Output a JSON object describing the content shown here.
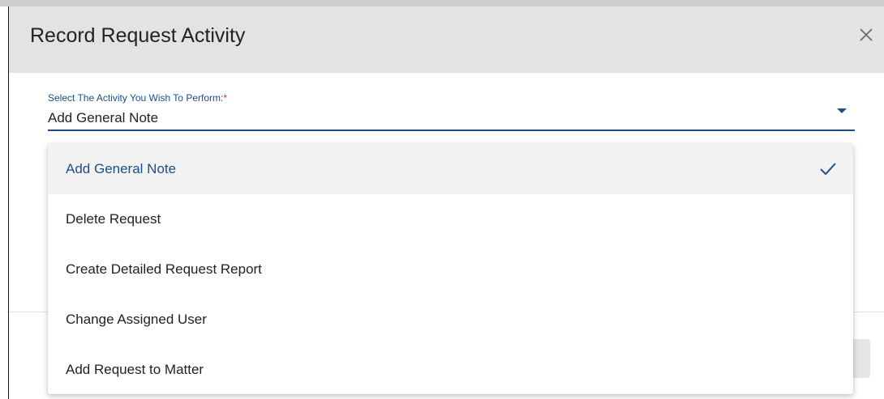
{
  "dialog": {
    "title": "Record Request Activity",
    "close_icon": "close-icon"
  },
  "field": {
    "label": "Select The Activity You Wish To Perform:",
    "required_marker": "*",
    "value": "Add General Note",
    "caret_icon": "caret-down-icon"
  },
  "menu": {
    "items": [
      {
        "label": "Add General Note",
        "selected": true
      },
      {
        "label": "Delete Request",
        "selected": false
      },
      {
        "label": "Create Detailed Request Report",
        "selected": false
      },
      {
        "label": "Change Assigned User",
        "selected": false
      },
      {
        "label": "Add Request to Matter",
        "selected": false
      }
    ],
    "check_icon": "check-icon"
  },
  "colors": {
    "accent": "#1f4e87",
    "required": "#d0302f",
    "header_bg": "#e3e3e3",
    "selected_bg": "#f2f2f2"
  }
}
